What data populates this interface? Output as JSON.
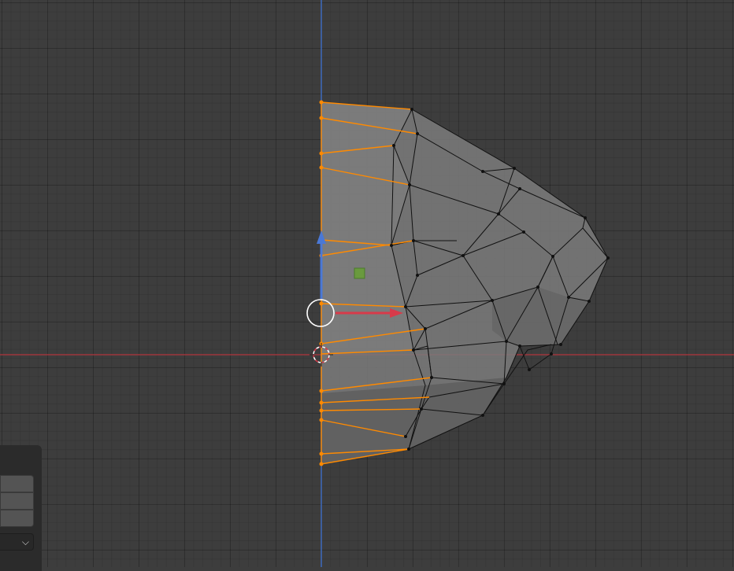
{
  "viewport": {
    "mode": "edit-mode-3d-viewport",
    "colors": {
      "background": "#3d3d3d",
      "mesh_face": "#7a7a7a",
      "selected_edge": "#ff8a00",
      "axis_x": "#c8323c",
      "axis_z": "#3c6ac8"
    }
  },
  "last_operation_panel": {
    "fields": [
      "",
      "",
      ""
    ],
    "dropdown_icon": "chevron-down-icon"
  }
}
